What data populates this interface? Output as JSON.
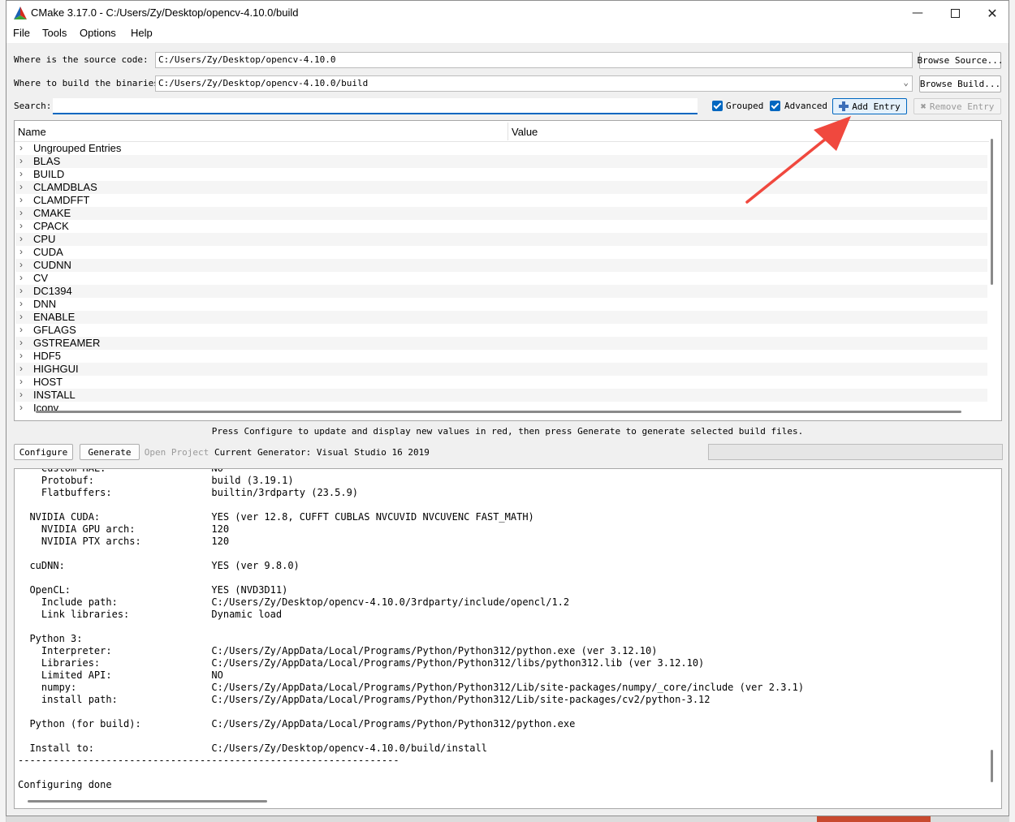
{
  "window": {
    "title": "CMake 3.17.0 - C:/Users/Zy/Desktop/opencv-4.10.0/build"
  },
  "menu": [
    "File",
    "Tools",
    "Options",
    "Help"
  ],
  "source": {
    "label": "Where is the source code:",
    "value": "C:/Users/Zy/Desktop/opencv-4.10.0",
    "button": "Browse Source..."
  },
  "binaries": {
    "label": "Where to build the binaries:",
    "value": "C:/Users/Zy/Desktop/opencv-4.10.0/build",
    "button": "Browse Build..."
  },
  "search": {
    "label": "Search:",
    "value": ""
  },
  "options": {
    "grouped_label": "Grouped",
    "grouped_checked": true,
    "advanced_label": "Advanced",
    "advanced_checked": true,
    "add_entry": "Add Entry",
    "remove_entry": "Remove Entry"
  },
  "tree": {
    "columns": [
      "Name",
      "Value"
    ],
    "rows": [
      "Ungrouped Entries",
      "BLAS",
      "BUILD",
      "CLAMDBLAS",
      "CLAMDFFT",
      "CMAKE",
      "CPACK",
      "CPU",
      "CUDA",
      "CUDNN",
      "CV",
      "DC1394",
      "DNN",
      "ENABLE",
      "GFLAGS",
      "GSTREAMER",
      "HDF5",
      "HIGHGUI",
      "HOST",
      "INSTALL",
      "Iconv"
    ]
  },
  "status_text": "Press Configure to update and display new values in red, then press Generate to generate selected build files.",
  "actions": {
    "configure": "Configure",
    "generate": "Generate",
    "open_project": "Open Project",
    "generator": "Current Generator: Visual Studio 16 2019"
  },
  "output_lines": [
    "    Custom HAL:                  NO",
    "    Protobuf:                    build (3.19.1)",
    "    Flatbuffers:                 builtin/3rdparty (23.5.9)",
    "",
    "  NVIDIA CUDA:                   YES (ver 12.8, CUFFT CUBLAS NVCUVID NVCUVENC FAST_MATH)",
    "    NVIDIA GPU arch:             120",
    "    NVIDIA PTX archs:            120",
    "",
    "  cuDNN:                         YES (ver 9.8.0)",
    "",
    "  OpenCL:                        YES (NVD3D11)",
    "    Include path:                C:/Users/Zy/Desktop/opencv-4.10.0/3rdparty/include/opencl/1.2",
    "    Link libraries:              Dynamic load",
    "",
    "  Python 3:",
    "    Interpreter:                 C:/Users/Zy/AppData/Local/Programs/Python/Python312/python.exe (ver 3.12.10)",
    "    Libraries:                   C:/Users/Zy/AppData/Local/Programs/Python/Python312/libs/python312.lib (ver 3.12.10)",
    "    Limited API:                 NO",
    "    numpy:                       C:/Users/Zy/AppData/Local/Programs/Python/Python312/Lib/site-packages/numpy/_core/include (ver 2.3.1)",
    "    install path:                C:/Users/Zy/AppData/Local/Programs/Python/Python312/Lib/site-packages/cv2/python-3.12",
    "",
    "  Python (for build):            C:/Users/Zy/AppData/Local/Programs/Python/Python312/python.exe",
    "",
    "  Install to:                    C:/Users/Zy/Desktop/opencv-4.10.0/build/install",
    "-----------------------------------------------------------------",
    "",
    "Configuring done"
  ],
  "colors": {
    "accent": "#0067c0",
    "annotation_arrow": "#f0483e"
  }
}
